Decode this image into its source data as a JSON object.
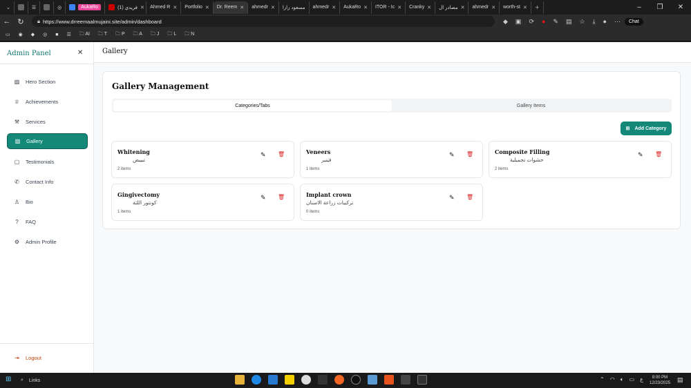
{
  "browser": {
    "tabs": [
      "",
      "",
      "",
      "",
      "",
      "AukaRo",
      "(1) فريدي",
      "Ahmed R",
      "Portfolio",
      "Dr. Reem",
      "ahmedr",
      "مسعود زارا",
      "ahmedr",
      "AukaRo",
      "ITOR - Ic",
      "Cranky",
      "مصادر ال",
      "ahmedr",
      "worth-st"
    ],
    "active_tab": 9,
    "url": "https://www.drreemaalmujaini.site/admin/dashboard",
    "bookmarks": [
      "AI",
      "T",
      "P",
      "A",
      "J",
      "L",
      "N"
    ],
    "chat_label": "Chat"
  },
  "sidebar": {
    "title": "Admin Panel",
    "items": [
      {
        "label": "Hero Section",
        "icon": "image-icon"
      },
      {
        "label": "Achievements",
        "icon": "trophy-icon"
      },
      {
        "label": "Services",
        "icon": "wrench-icon"
      },
      {
        "label": "Gallery",
        "icon": "image-icon",
        "active": true
      },
      {
        "label": "Testimonials",
        "icon": "message-icon"
      },
      {
        "label": "Contact Info",
        "icon": "phone-icon"
      },
      {
        "label": "Bio",
        "icon": "user-icon"
      },
      {
        "label": "FAQ",
        "icon": "help-icon"
      },
      {
        "label": "Admin Profile",
        "icon": "gear-icon"
      }
    ],
    "logout": "Logout"
  },
  "header": {
    "title": "Gallery"
  },
  "main": {
    "title": "Gallery Management",
    "tabs": [
      "Categories/Tabs",
      "Gallery Items"
    ],
    "add_button": "Add Category",
    "categories": [
      {
        "name": "Whitening",
        "arabic": "تبييض",
        "count": "2 items"
      },
      {
        "name": "Veneers",
        "arabic": "فينير",
        "count": "1 items"
      },
      {
        "name": "Composite Filling",
        "arabic": "حشوات تجميلية",
        "count": "2 items"
      },
      {
        "name": "Gingivectomy",
        "arabic": "كونتور اللثة",
        "count": "1 items"
      },
      {
        "name": "Implant crown",
        "arabic": "تركيبات زراعة الاسنان",
        "count": "0 items"
      }
    ]
  },
  "taskbar": {
    "search": "Links",
    "time": "8:00 PM",
    "date": "12/23/2025",
    "lang": "ع"
  },
  "colors": {
    "accent": "#14897a",
    "danger": "#dc2626"
  }
}
